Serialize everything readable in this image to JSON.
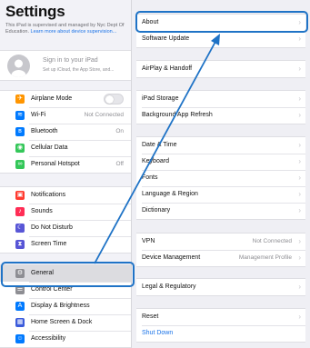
{
  "sidebar": {
    "title": "Settings",
    "supervised_text": "This iPad is supervised and managed by Nyc Dept Of Education.",
    "supervised_link": "Learn more about device supervision...",
    "signin_title": "Sign in to your iPad",
    "signin_sub": "Set up iCloud, the App Store, and...",
    "group1": [
      {
        "label": "Airplane Mode",
        "value": "",
        "toggle": true,
        "color": "#ff9500",
        "icon": "airplane-icon",
        "glyph": "✈"
      },
      {
        "label": "Wi-Fi",
        "value": "Not Connected",
        "color": "#007aff",
        "icon": "wifi-icon",
        "glyph": "≋"
      },
      {
        "label": "Bluetooth",
        "value": "On",
        "color": "#007aff",
        "icon": "bluetooth-icon",
        "glyph": "ʙ"
      },
      {
        "label": "Cellular Data",
        "value": "",
        "color": "#34c759",
        "icon": "cellular-icon",
        "glyph": "◉"
      },
      {
        "label": "Personal Hotspot",
        "value": "Off",
        "color": "#34c759",
        "icon": "hotspot-icon",
        "glyph": "∞"
      }
    ],
    "group2": [
      {
        "label": "Notifications",
        "color": "#ff3b30",
        "icon": "notifications-icon",
        "glyph": "▣"
      },
      {
        "label": "Sounds",
        "color": "#ff2d55",
        "icon": "sounds-icon",
        "glyph": "♪"
      },
      {
        "label": "Do Not Disturb",
        "color": "#5856d6",
        "icon": "moon-icon",
        "glyph": "☾"
      },
      {
        "label": "Screen Time",
        "color": "#5856d6",
        "icon": "hourglass-icon",
        "glyph": "⧗"
      }
    ],
    "group3": [
      {
        "label": "General",
        "color": "#8e8e93",
        "icon": "gear-icon",
        "glyph": "⚙"
      },
      {
        "label": "Control Center",
        "color": "#8e8e93",
        "icon": "control-center-icon",
        "glyph": "☰"
      },
      {
        "label": "Display & Brightness",
        "color": "#007aff",
        "icon": "display-icon",
        "glyph": "A"
      },
      {
        "label": "Home Screen & Dock",
        "color": "#3b5bdb",
        "icon": "home-screen-icon",
        "glyph": "▦"
      },
      {
        "label": "Accessibility",
        "color": "#007aff",
        "icon": "accessibility-icon",
        "glyph": "☺"
      }
    ]
  },
  "main": {
    "group1": [
      {
        "label": "About",
        "value": ""
      },
      {
        "label": "Software Update",
        "value": ""
      }
    ],
    "group2": [
      {
        "label": "AirPlay & Handoff",
        "value": ""
      }
    ],
    "group3": [
      {
        "label": "iPad Storage",
        "value": ""
      },
      {
        "label": "Background App Refresh",
        "value": ""
      }
    ],
    "group4": [
      {
        "label": "Date & Time",
        "value": ""
      },
      {
        "label": "Keyboard",
        "value": ""
      },
      {
        "label": "Fonts",
        "value": ""
      },
      {
        "label": "Language & Region",
        "value": ""
      },
      {
        "label": "Dictionary",
        "value": ""
      }
    ],
    "group5": [
      {
        "label": "VPN",
        "value": "Not Connected"
      },
      {
        "label": "Device Management",
        "value": "Management Profile"
      }
    ],
    "group6": [
      {
        "label": "Legal & Regulatory",
        "value": ""
      }
    ],
    "group7": [
      {
        "label": "Reset",
        "value": ""
      },
      {
        "label": "Shut Down",
        "value": ""
      }
    ]
  },
  "colors": {
    "accent": "#1a73e8",
    "annotation": "#1f73c6"
  }
}
